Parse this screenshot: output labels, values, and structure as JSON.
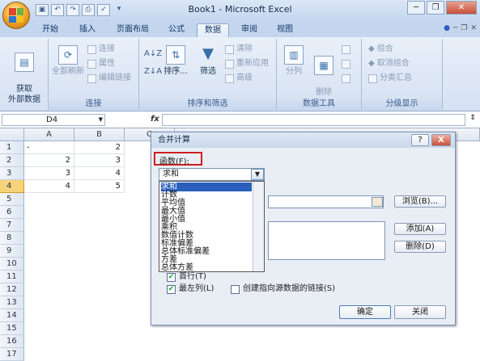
{
  "window": {
    "title": "Book1 - Microsoft Excel"
  },
  "tabs": [
    {
      "label": "开始",
      "active": false
    },
    {
      "label": "插入",
      "active": false
    },
    {
      "label": "页面布局",
      "active": false
    },
    {
      "label": "公式",
      "active": false
    },
    {
      "label": "数据",
      "active": true
    },
    {
      "label": "审阅",
      "active": false
    },
    {
      "label": "视图",
      "active": false
    }
  ],
  "ribbon": {
    "get_external": "获取\n外部数据",
    "refresh_all": "全部刷新",
    "connections": "连接",
    "properties": "属性",
    "edit_links": "编辑链接",
    "group_connections": "连接",
    "sort": "排序...",
    "filter": "筛选",
    "clear": "清除",
    "reapply": "重新应用",
    "advanced": "高级",
    "group_sort": "排序和筛选",
    "text_to_columns": "分列",
    "remove_duplicates": "删除\n重复项",
    "group_tools": "数据工具",
    "group": "组合",
    "ungroup": "取消组合",
    "subtotal": "分类汇总",
    "group_outline": "分级显示"
  },
  "formula_bar": {
    "name_box": "D4",
    "fx": "fx",
    "formula": ""
  },
  "grid": {
    "columns": [
      "A",
      "B",
      "C"
    ],
    "rows": [
      "1",
      "2",
      "3",
      "4",
      "5",
      "6",
      "7",
      "8",
      "9",
      "10",
      "11",
      "12",
      "13",
      "14",
      "15",
      "16",
      "17"
    ],
    "selected_row": "4",
    "cells": {
      "A1": "-",
      "B1": "2",
      "A2": "2",
      "B2": "3",
      "A3": "3",
      "B3": "4",
      "A4": "4",
      "B4": "5"
    }
  },
  "dialog": {
    "title": "合并计算",
    "help": "?",
    "close": "X",
    "function_label": "函数(F):",
    "function_value": "求和",
    "function_options": [
      "求和",
      "计数",
      "平均值",
      "最大值",
      "最小值",
      "乘积",
      "数值计数",
      "标准偏差",
      "总体标准偏差",
      "方差",
      "总体方差"
    ],
    "selected_option": "求和",
    "browse_button": "浏览(B)...",
    "add_button": "添加(A)",
    "delete_button": "删除(D)",
    "top_row": "首行(T)",
    "left_column": "最左列(L)",
    "create_links": "创建指向源数据的链接(S)",
    "ok_button": "确定",
    "close_button": "关闭",
    "top_row_checked": true,
    "left_column_checked": true,
    "create_links_checked": false
  }
}
